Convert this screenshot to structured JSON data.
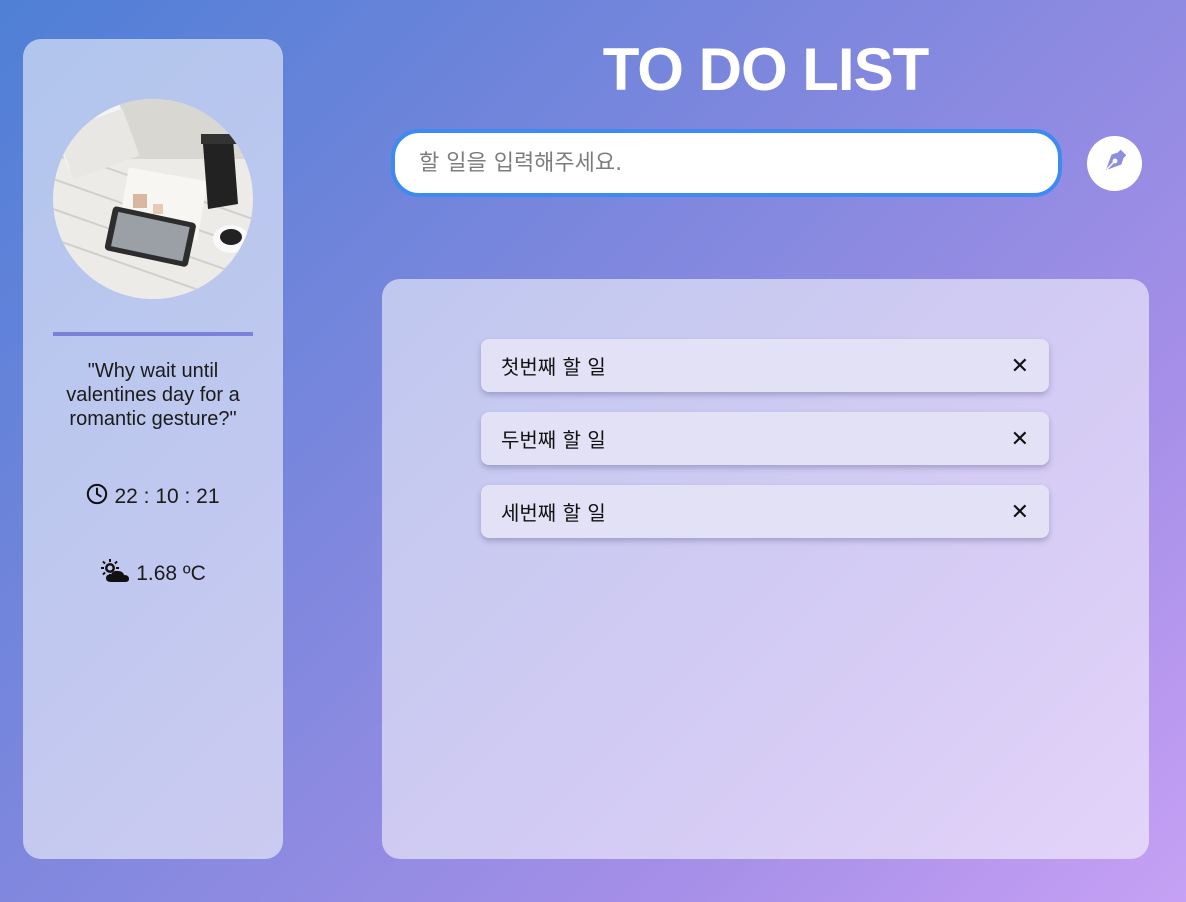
{
  "sidebar": {
    "quote": "\"Why wait until valentines day for a romantic gesture?\"",
    "clock": "22 : 10 : 21",
    "weather": "1.68 ºC"
  },
  "header": {
    "title": "TO DO LIST"
  },
  "input": {
    "placeholder": "할 일을 입력해주세요.",
    "value": ""
  },
  "todos": [
    {
      "text": "첫번째 할 일",
      "delete_label": "✕"
    },
    {
      "text": "두번째 할 일",
      "delete_label": "✕"
    },
    {
      "text": "세번째 할 일",
      "delete_label": "✕"
    }
  ],
  "icons": {
    "add_button": "pen-nib-icon",
    "clock": "clock-icon",
    "weather": "cloud-sun-icon"
  },
  "colors": {
    "accent": "#3d8bf0",
    "divider": "#7b80d8",
    "item_bg": "#e3e1f6"
  }
}
